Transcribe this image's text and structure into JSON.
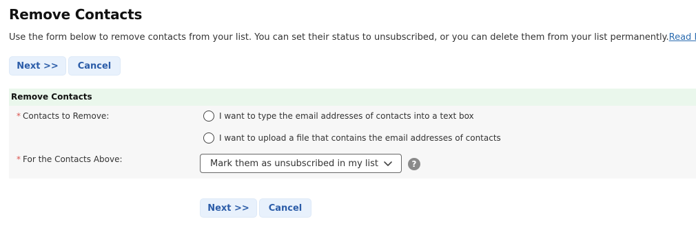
{
  "page": {
    "title": "Remove Contacts",
    "intro_text": "Use the form below to remove contacts from your list. You can set their status to unsubscribed, or you can delete them from your list permanently.",
    "read_more": "Read More"
  },
  "top_buttons": {
    "next": "Next >>",
    "cancel": "Cancel"
  },
  "panel": {
    "title": "Remove Contacts",
    "contacts_to_remove": {
      "required_mark": "*",
      "label": "Contacts to Remove:",
      "options": [
        "I want to type the email addresses of contacts into a text box",
        "I want to upload a file that contains the email addresses of contacts"
      ]
    },
    "for_contacts_above": {
      "required_mark": "*",
      "label": "For the Contacts Above:",
      "selected": "Mark them as unsubscribed in my list",
      "help_icon": "question-circle-icon",
      "help_symbol": "?"
    }
  },
  "bottom_buttons": {
    "next": "Next >>",
    "cancel": "Cancel"
  },
  "colors": {
    "button_bg": "#e8f1fc",
    "button_text": "#2b5ca8",
    "panel_header_bg": "#eaf7ec",
    "panel_bg": "#f7f7f7",
    "required": "#d9534f",
    "link": "#2b6cb0"
  }
}
